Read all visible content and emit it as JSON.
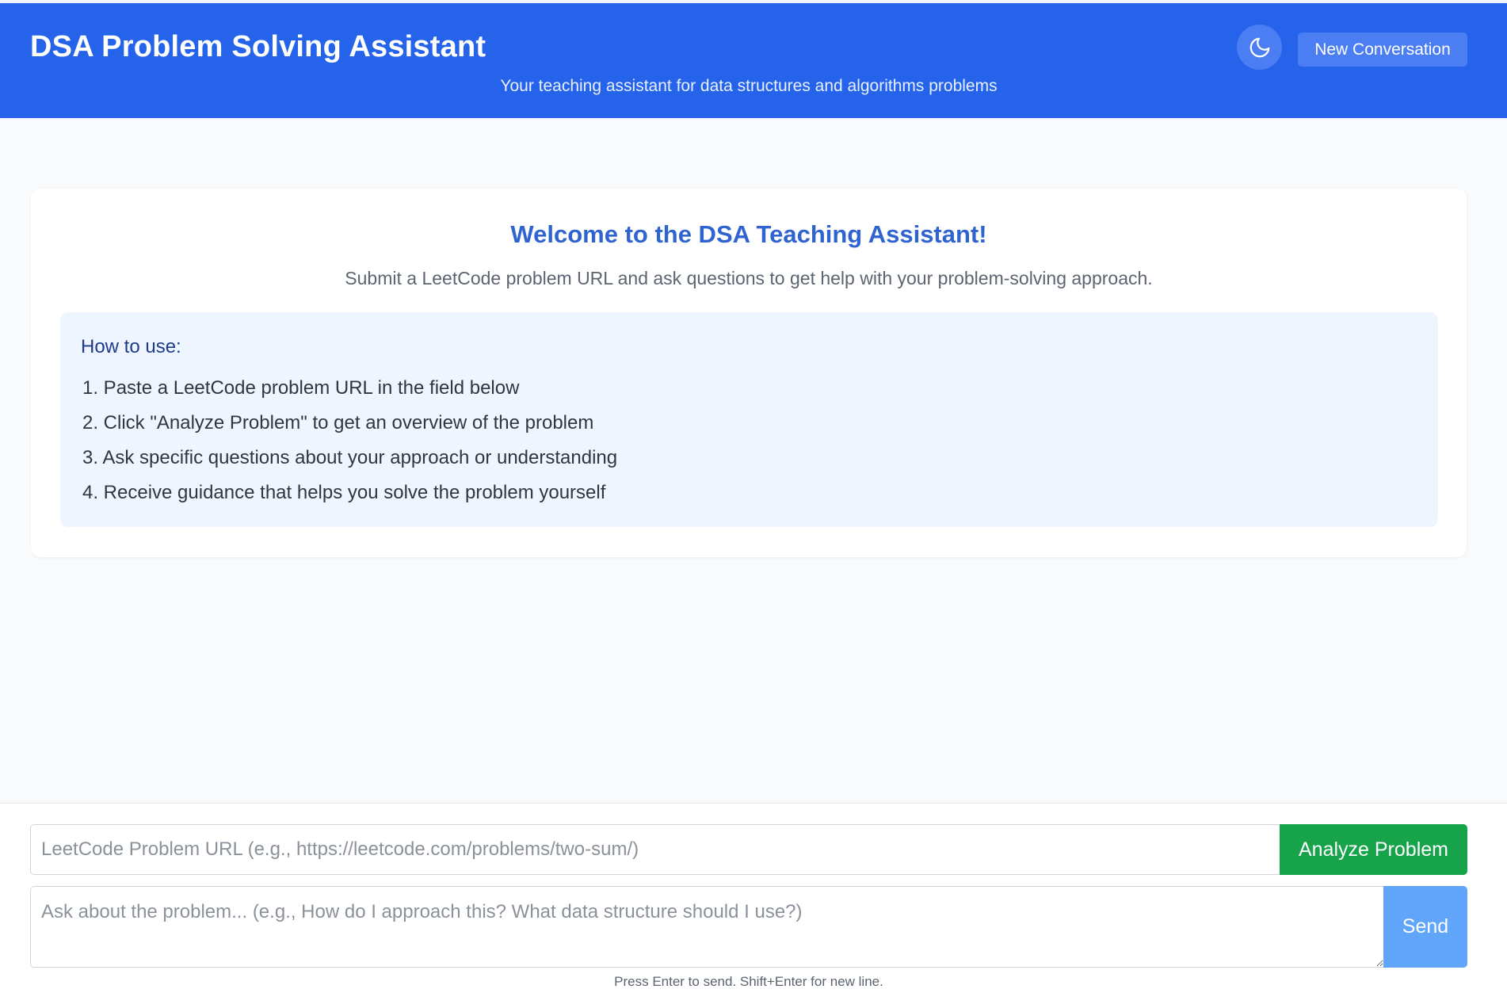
{
  "header": {
    "title": "DSA Problem Solving Assistant",
    "subtitle": "Your teaching assistant for data structures and algorithms problems",
    "theme_toggle_icon": "moon-icon",
    "new_conversation_label": "New Conversation"
  },
  "welcome": {
    "title": "Welcome to the DSA Teaching Assistant!",
    "text": "Submit a LeetCode problem URL and ask questions to get help with your problem-solving approach.",
    "howto_title": "How to use:",
    "steps": [
      "1. Paste a LeetCode problem URL in the field below",
      "2. Click \"Analyze Problem\" to get an overview of the problem",
      "3. Ask specific questions about your approach or understanding",
      "4. Receive guidance that helps you solve the problem yourself"
    ]
  },
  "input": {
    "url_placeholder": "LeetCode Problem URL (e.g., https://leetcode.com/problems/two-sum/)",
    "analyze_label": "Analyze Problem",
    "question_placeholder": "Ask about the problem... (e.g., How do I approach this? What data structure should I use?)",
    "send_label": "Send",
    "hint": "Press Enter to send. Shift+Enter for new line."
  },
  "colors": {
    "header_bg": "#2563eb",
    "analyze_bg": "#16a34a",
    "send_bg": "#60a5fa",
    "welcome_title": "#2f63cf"
  }
}
